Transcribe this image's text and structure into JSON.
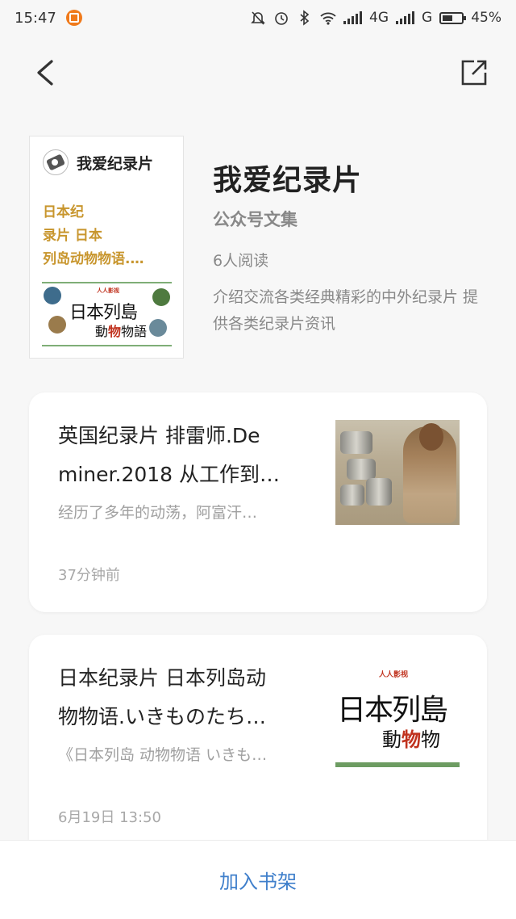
{
  "status_bar": {
    "time": "15:47",
    "network_1": "4G",
    "network_2": "G",
    "battery": "45%",
    "icons": [
      "notification-app-icon",
      "mute-icon",
      "alarm-icon",
      "bluetooth-icon",
      "wifi-icon",
      "signal-icon",
      "battery-icon"
    ]
  },
  "nav": {
    "back_icon": "chevron-left-icon",
    "share_icon": "share-external-icon"
  },
  "header": {
    "cover": {
      "account_name": "我爱纪录片",
      "title_lines": [
        "日本纪",
        "录片 日本",
        "列岛动物物语.…"
      ],
      "thumb_title": "日本列島",
      "thumb_sub_prefix": "動",
      "thumb_sub_highlight": "物",
      "thumb_sub_suffix": "物語",
      "thumb_logo": "人人影视"
    },
    "title": "我爱纪录片",
    "subtitle": "公众号文集",
    "readers": "6人阅读",
    "description": "介绍交流各类经典精彩的中外纪录片 提供各类纪录片资讯"
  },
  "articles": [
    {
      "title_lines": [
        "英国纪录片 排雷师.De",
        "miner.2018 从工作到…"
      ],
      "summary": "经历了多年的动荡，阿富汗…",
      "time": "37分钟前"
    },
    {
      "title_lines": [
        "日本纪录片 日本列岛动",
        "物物语.いきものたち…"
      ],
      "summary": "《日本列岛 动物物语 いきも…",
      "time": "6月19日 13:50",
      "thumb_title": "日本列島",
      "thumb_sub_prefix": "動",
      "thumb_sub_highlight": "物",
      "thumb_sub_suffix": "物",
      "thumb_logo": "人人影视"
    }
  ],
  "bottom": {
    "add_label": "加入书架"
  },
  "colors": {
    "accent": "#3f7fcb",
    "cover_title": "#c8962e",
    "muted": "#888888"
  }
}
